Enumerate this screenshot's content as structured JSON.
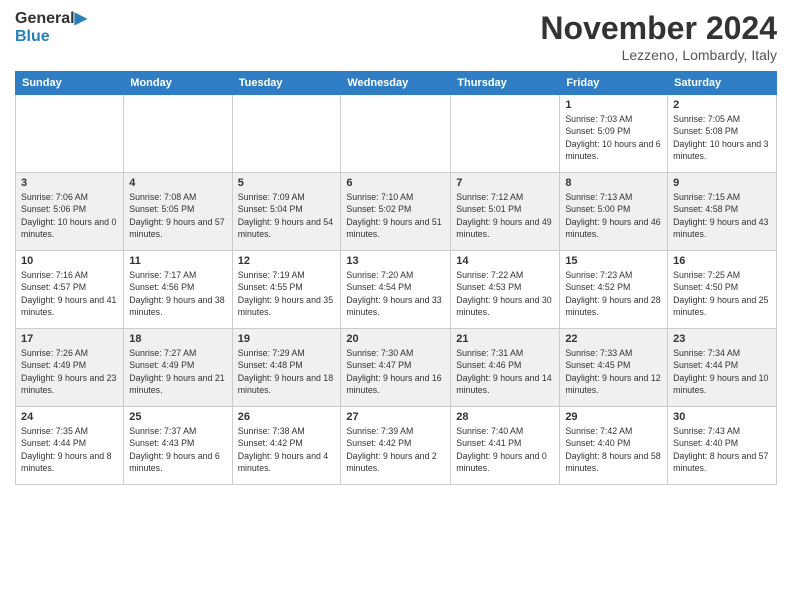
{
  "logo": {
    "line1": "General",
    "line2": "Blue"
  },
  "title": "November 2024",
  "location": "Lezzeno, Lombardy, Italy",
  "weekdays": [
    "Sunday",
    "Monday",
    "Tuesday",
    "Wednesday",
    "Thursday",
    "Friday",
    "Saturday"
  ],
  "weeks": [
    [
      {
        "day": "",
        "info": ""
      },
      {
        "day": "",
        "info": ""
      },
      {
        "day": "",
        "info": ""
      },
      {
        "day": "",
        "info": ""
      },
      {
        "day": "",
        "info": ""
      },
      {
        "day": "1",
        "info": "Sunrise: 7:03 AM\nSunset: 5:09 PM\nDaylight: 10 hours and 6 minutes."
      },
      {
        "day": "2",
        "info": "Sunrise: 7:05 AM\nSunset: 5:08 PM\nDaylight: 10 hours and 3 minutes."
      }
    ],
    [
      {
        "day": "3",
        "info": "Sunrise: 7:06 AM\nSunset: 5:06 PM\nDaylight: 10 hours and 0 minutes."
      },
      {
        "day": "4",
        "info": "Sunrise: 7:08 AM\nSunset: 5:05 PM\nDaylight: 9 hours and 57 minutes."
      },
      {
        "day": "5",
        "info": "Sunrise: 7:09 AM\nSunset: 5:04 PM\nDaylight: 9 hours and 54 minutes."
      },
      {
        "day": "6",
        "info": "Sunrise: 7:10 AM\nSunset: 5:02 PM\nDaylight: 9 hours and 51 minutes."
      },
      {
        "day": "7",
        "info": "Sunrise: 7:12 AM\nSunset: 5:01 PM\nDaylight: 9 hours and 49 minutes."
      },
      {
        "day": "8",
        "info": "Sunrise: 7:13 AM\nSunset: 5:00 PM\nDaylight: 9 hours and 46 minutes."
      },
      {
        "day": "9",
        "info": "Sunrise: 7:15 AM\nSunset: 4:58 PM\nDaylight: 9 hours and 43 minutes."
      }
    ],
    [
      {
        "day": "10",
        "info": "Sunrise: 7:16 AM\nSunset: 4:57 PM\nDaylight: 9 hours and 41 minutes."
      },
      {
        "day": "11",
        "info": "Sunrise: 7:17 AM\nSunset: 4:56 PM\nDaylight: 9 hours and 38 minutes."
      },
      {
        "day": "12",
        "info": "Sunrise: 7:19 AM\nSunset: 4:55 PM\nDaylight: 9 hours and 35 minutes."
      },
      {
        "day": "13",
        "info": "Sunrise: 7:20 AM\nSunset: 4:54 PM\nDaylight: 9 hours and 33 minutes."
      },
      {
        "day": "14",
        "info": "Sunrise: 7:22 AM\nSunset: 4:53 PM\nDaylight: 9 hours and 30 minutes."
      },
      {
        "day": "15",
        "info": "Sunrise: 7:23 AM\nSunset: 4:52 PM\nDaylight: 9 hours and 28 minutes."
      },
      {
        "day": "16",
        "info": "Sunrise: 7:25 AM\nSunset: 4:50 PM\nDaylight: 9 hours and 25 minutes."
      }
    ],
    [
      {
        "day": "17",
        "info": "Sunrise: 7:26 AM\nSunset: 4:49 PM\nDaylight: 9 hours and 23 minutes."
      },
      {
        "day": "18",
        "info": "Sunrise: 7:27 AM\nSunset: 4:49 PM\nDaylight: 9 hours and 21 minutes."
      },
      {
        "day": "19",
        "info": "Sunrise: 7:29 AM\nSunset: 4:48 PM\nDaylight: 9 hours and 18 minutes."
      },
      {
        "day": "20",
        "info": "Sunrise: 7:30 AM\nSunset: 4:47 PM\nDaylight: 9 hours and 16 minutes."
      },
      {
        "day": "21",
        "info": "Sunrise: 7:31 AM\nSunset: 4:46 PM\nDaylight: 9 hours and 14 minutes."
      },
      {
        "day": "22",
        "info": "Sunrise: 7:33 AM\nSunset: 4:45 PM\nDaylight: 9 hours and 12 minutes."
      },
      {
        "day": "23",
        "info": "Sunrise: 7:34 AM\nSunset: 4:44 PM\nDaylight: 9 hours and 10 minutes."
      }
    ],
    [
      {
        "day": "24",
        "info": "Sunrise: 7:35 AM\nSunset: 4:44 PM\nDaylight: 9 hours and 8 minutes."
      },
      {
        "day": "25",
        "info": "Sunrise: 7:37 AM\nSunset: 4:43 PM\nDaylight: 9 hours and 6 minutes."
      },
      {
        "day": "26",
        "info": "Sunrise: 7:38 AM\nSunset: 4:42 PM\nDaylight: 9 hours and 4 minutes."
      },
      {
        "day": "27",
        "info": "Sunrise: 7:39 AM\nSunset: 4:42 PM\nDaylight: 9 hours and 2 minutes."
      },
      {
        "day": "28",
        "info": "Sunrise: 7:40 AM\nSunset: 4:41 PM\nDaylight: 9 hours and 0 minutes."
      },
      {
        "day": "29",
        "info": "Sunrise: 7:42 AM\nSunset: 4:40 PM\nDaylight: 8 hours and 58 minutes."
      },
      {
        "day": "30",
        "info": "Sunrise: 7:43 AM\nSunset: 4:40 PM\nDaylight: 8 hours and 57 minutes."
      }
    ]
  ]
}
